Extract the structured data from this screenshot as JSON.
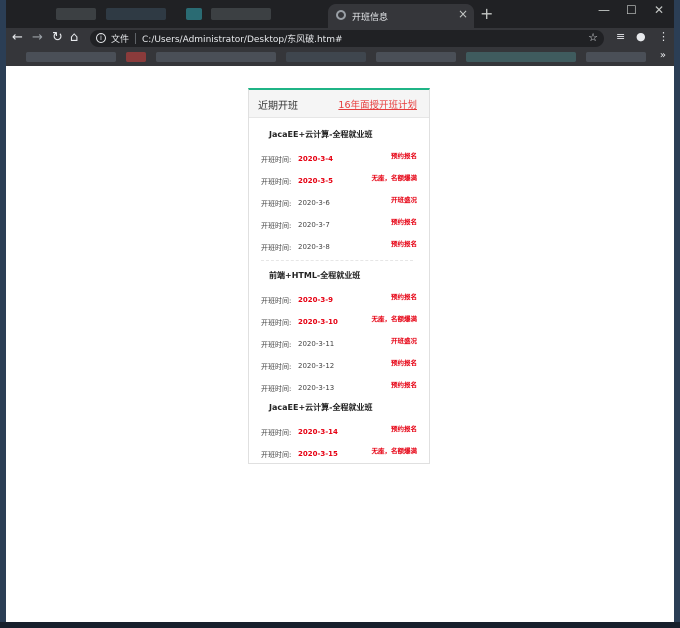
{
  "browser": {
    "tab_title": "开班信息",
    "tab_close": "×",
    "new_tab": "+",
    "window_controls": [
      "—",
      "☐",
      "✕"
    ],
    "nav": {
      "back": "←",
      "forward": "→",
      "reload": "↻",
      "home": "⌂"
    },
    "address": {
      "scheme_label": "文件",
      "url": "C:/Users/Administrator/Desktop/东风破.htm#"
    },
    "bookmarks_more": "»"
  },
  "panel": {
    "title": "近期开班",
    "link": "16年面授开班计划",
    "date_label": "开班时间:",
    "courses": [
      {
        "name": "JacaEE+云计算-全程就业班",
        "rows": [
          {
            "date": "2020-3-4",
            "highlight": true,
            "status": "预约报名"
          },
          {
            "date": "2020-3-5",
            "highlight": true,
            "status": "无座，名额爆满"
          },
          {
            "date": "2020-3-6",
            "highlight": false,
            "status": "开班盛况"
          },
          {
            "date": "2020-3-7",
            "highlight": false,
            "status": "预约报名"
          },
          {
            "date": "2020-3-8",
            "highlight": false,
            "status": "预约报名"
          }
        ]
      },
      {
        "name": "前端+HTML-全程就业班",
        "rows": [
          {
            "date": "2020-3-9",
            "highlight": true,
            "status": "预约报名"
          },
          {
            "date": "2020-3-10",
            "highlight": true,
            "status": "无座，名额爆满"
          },
          {
            "date": "2020-3-11",
            "highlight": false,
            "status": "开班盛况"
          },
          {
            "date": "2020-3-12",
            "highlight": false,
            "status": "预约报名"
          },
          {
            "date": "2020-3-13",
            "highlight": false,
            "status": "预约报名"
          }
        ]
      },
      {
        "name": "JacaEE+云计算-全程就业班",
        "rows": [
          {
            "date": "2020-3-14",
            "highlight": true,
            "status": "预约报名"
          },
          {
            "date": "2020-3-15",
            "highlight": true,
            "status": "无座，名额爆满"
          }
        ]
      }
    ]
  },
  "colors": {
    "accent_border": "#1fb486",
    "highlight_red": "#e60012",
    "link_red": "#e63c3c"
  }
}
